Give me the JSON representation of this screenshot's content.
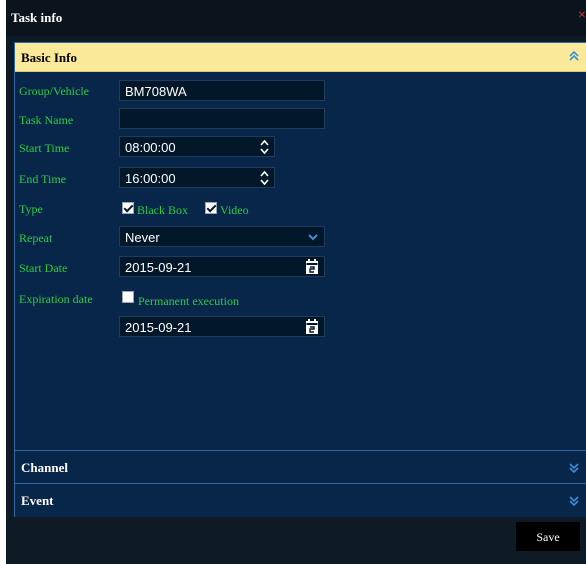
{
  "window": {
    "title": "Task info",
    "close_symbol": "×"
  },
  "sections": {
    "basic": {
      "title": "Basic Info",
      "expanded": true
    },
    "channel": {
      "title": "Channel",
      "expanded": false
    },
    "event": {
      "title": "Event",
      "expanded": false
    }
  },
  "form": {
    "group_vehicle": {
      "label": "Group/Vehicle",
      "value": "BM708WA"
    },
    "task_name": {
      "label": "Task Name",
      "value": ""
    },
    "start_time": {
      "label": "Start Time",
      "value": "08:00:00"
    },
    "end_time": {
      "label": "End Time",
      "value": "16:00:00"
    },
    "type": {
      "label": "Type",
      "options": [
        {
          "label": "Black Box",
          "checked": true
        },
        {
          "label": "Video",
          "checked": true
        }
      ]
    },
    "repeat": {
      "label": "Repeat",
      "value": "Never"
    },
    "start_date": {
      "label": "Start Date",
      "value": "2015-09-21"
    },
    "expiration_date": {
      "label": "Expiration date",
      "permanent_label": "Permanent execution",
      "permanent_checked": false,
      "value": "2015-09-21"
    }
  },
  "buttons": {
    "save": "Save"
  },
  "colors": {
    "label_green": "#2ecc40",
    "panel_bg": "#08264a",
    "header_yellow": "#fbe99a",
    "accent_blue": "#2b6aa6"
  },
  "icons": {
    "close": "close-icon",
    "collapse": "double-chevron-up-icon",
    "expand": "double-chevron-down-icon",
    "spinner": "spinner-icon",
    "dropdown": "chevron-down-icon",
    "calendar": "calendar-icon"
  }
}
